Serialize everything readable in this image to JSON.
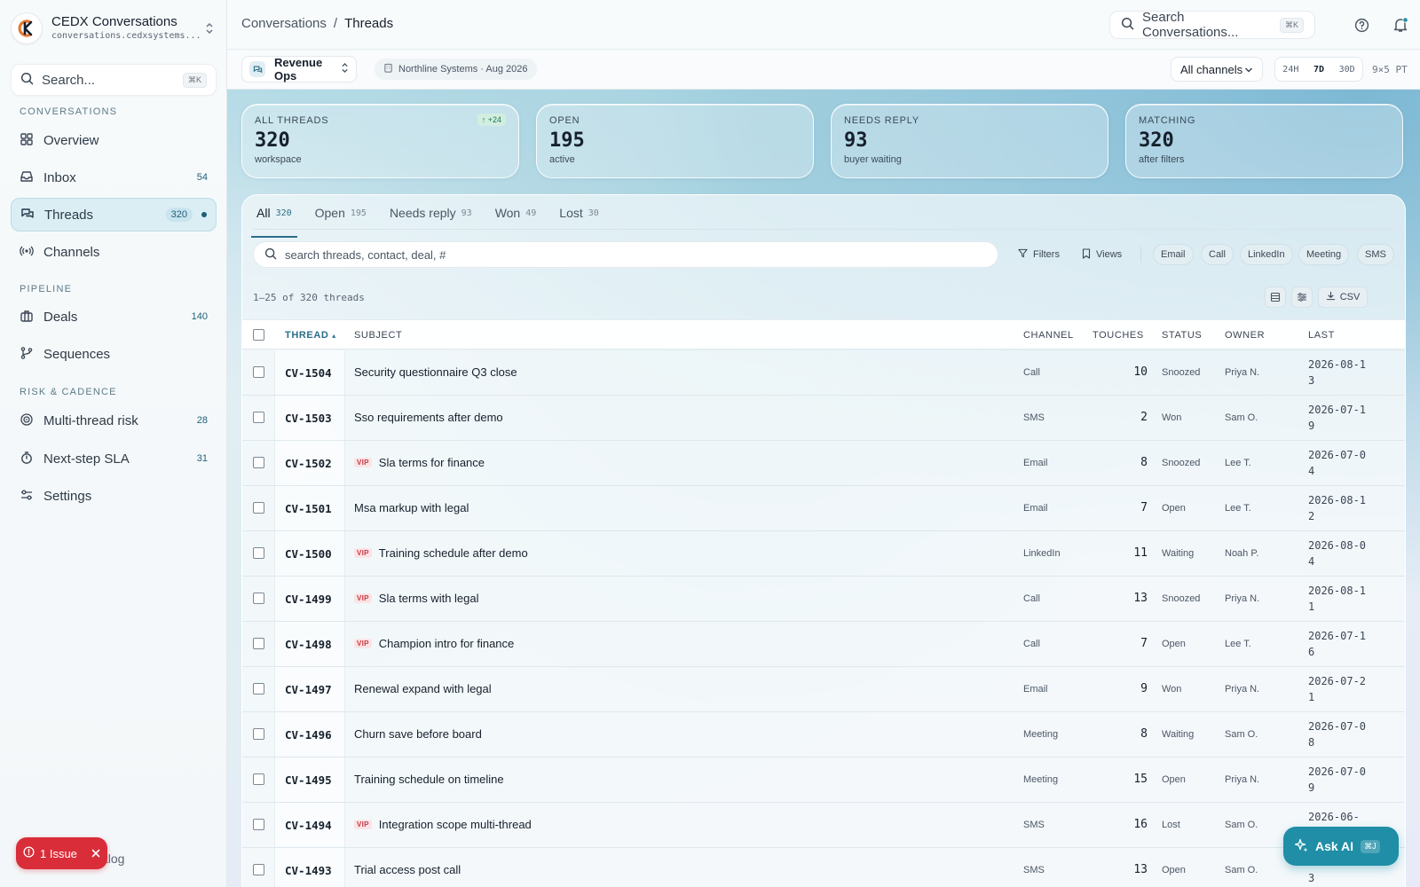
{
  "app": {
    "name": "CEDX Conversations",
    "domain": "conversations.cedxsystems..."
  },
  "sidebar": {
    "search_label": "Search...",
    "search_kbd": "⌘K",
    "sections": {
      "conversations": "CONVERSATIONS",
      "pipeline": "PIPELINE",
      "risk": "RISK & CADENCE"
    },
    "items": [
      {
        "label": "Overview",
        "count": "",
        "icon": "grid-icon"
      },
      {
        "label": "Inbox",
        "count": "54",
        "icon": "inbox-icon"
      },
      {
        "label": "Threads",
        "count": "320",
        "icon": "chat-bubbles-icon",
        "active": true
      },
      {
        "label": "Channels",
        "count": "",
        "icon": "broadcast-icon"
      },
      {
        "label": "Deals",
        "count": "140",
        "icon": "briefcase-icon"
      },
      {
        "label": "Sequences",
        "count": "",
        "icon": "branch-icon"
      },
      {
        "label": "Multi-thread risk",
        "count": "28",
        "icon": "target-icon"
      },
      {
        "label": "Next-step SLA",
        "count": "31",
        "icon": "timer-icon"
      },
      {
        "label": "Settings",
        "count": "",
        "icon": "sliders-icon"
      }
    ],
    "issue_label": "1 Issue",
    "catalog_tail": "alog"
  },
  "topbar": {
    "breadcrumb_root": "Conversations",
    "breadcrumb_sep": "/",
    "breadcrumb_current": "Threads",
    "search_label": "Search Conversations...",
    "search_kbd": "⌘K"
  },
  "subbar": {
    "workspace": "Revenue Ops",
    "org": "Northline Systems · Aug 2026",
    "channel_select": "All channels",
    "ranges": [
      "24H",
      "7D",
      "30D"
    ],
    "range_active": "7D",
    "timezone": "9×5 PT"
  },
  "stats": [
    {
      "label": "ALL THREADS",
      "value": "320",
      "sub": "workspace",
      "delta": "↑ +24"
    },
    {
      "label": "OPEN",
      "value": "195",
      "sub": "active",
      "delta": ""
    },
    {
      "label": "NEEDS REPLY",
      "value": "93",
      "sub": "buyer waiting",
      "delta": ""
    },
    {
      "label": "MATCHING",
      "value": "320",
      "sub": "after filters",
      "delta": ""
    }
  ],
  "tabs": [
    {
      "label": "All",
      "count": "320",
      "active": true
    },
    {
      "label": "Open",
      "count": "195"
    },
    {
      "label": "Needs reply",
      "count": "93"
    },
    {
      "label": "Won",
      "count": "49"
    },
    {
      "label": "Lost",
      "count": "30"
    }
  ],
  "toolbar": {
    "search_placeholder": "search threads, contact, deal, #",
    "filters": "Filters",
    "views": "Views",
    "chips": [
      "Email",
      "Call",
      "LinkedIn",
      "Meeting",
      "SMS"
    ],
    "range_text": "1–25 of 320 threads",
    "csv": "CSV"
  },
  "table": {
    "headers": {
      "thread": "THREAD",
      "sort_indicator": "▴",
      "subject": "SUBJECT",
      "channel": "CHANNEL",
      "touches": "TOUCHES",
      "status": "STATUS",
      "owner": "OWNER",
      "last": "LAST"
    },
    "vip_label": "VIP",
    "rows": [
      {
        "id": "CV-1504",
        "subject": "Security questionnaire Q3 close",
        "vip": false,
        "channel": "Call",
        "touches": "10",
        "status": "Snoozed",
        "owner": "Priya N.",
        "last": "2026-08-13"
      },
      {
        "id": "CV-1503",
        "subject": "Sso requirements after demo",
        "vip": false,
        "channel": "SMS",
        "touches": "2",
        "status": "Won",
        "owner": "Sam O.",
        "last": "2026-07-19"
      },
      {
        "id": "CV-1502",
        "subject": "Sla terms for finance",
        "vip": true,
        "channel": "Email",
        "touches": "8",
        "status": "Snoozed",
        "owner": "Lee T.",
        "last": "2026-07-04"
      },
      {
        "id": "CV-1501",
        "subject": "Msa markup with legal",
        "vip": false,
        "channel": "Email",
        "touches": "7",
        "status": "Open",
        "owner": "Lee T.",
        "last": "2026-08-12"
      },
      {
        "id": "CV-1500",
        "subject": "Training schedule after demo",
        "vip": true,
        "channel": "LinkedIn",
        "touches": "11",
        "status": "Waiting",
        "owner": "Noah P.",
        "last": "2026-08-04"
      },
      {
        "id": "CV-1499",
        "subject": "Sla terms with legal",
        "vip": true,
        "channel": "Call",
        "touches": "13",
        "status": "Snoozed",
        "owner": "Priya N.",
        "last": "2026-08-11"
      },
      {
        "id": "CV-1498",
        "subject": "Champion intro for finance",
        "vip": true,
        "channel": "Call",
        "touches": "7",
        "status": "Open",
        "owner": "Lee T.",
        "last": "2026-07-16"
      },
      {
        "id": "CV-1497",
        "subject": "Renewal expand with legal",
        "vip": false,
        "channel": "Email",
        "touches": "9",
        "status": "Won",
        "owner": "Priya N.",
        "last": "2026-07-21"
      },
      {
        "id": "CV-1496",
        "subject": "Churn save before board",
        "vip": false,
        "channel": "Meeting",
        "touches": "8",
        "status": "Waiting",
        "owner": "Sam O.",
        "last": "2026-07-08"
      },
      {
        "id": "CV-1495",
        "subject": "Training schedule on timeline",
        "vip": false,
        "channel": "Meeting",
        "touches": "15",
        "status": "Open",
        "owner": "Priya N.",
        "last": "2026-07-09"
      },
      {
        "id": "CV-1494",
        "subject": "Integration scope multi-thread",
        "vip": true,
        "channel": "SMS",
        "touches": "16",
        "status": "Lost",
        "owner": "Sam O.",
        "last": "2026-06-"
      },
      {
        "id": "CV-1493",
        "subject": "Trial access post call",
        "vip": false,
        "channel": "SMS",
        "touches": "13",
        "status": "Open",
        "owner": "Sam O.",
        "last": "2026-05-13"
      }
    ]
  },
  "ask_ai": {
    "label": "Ask AI",
    "kbd": "⌘J"
  }
}
